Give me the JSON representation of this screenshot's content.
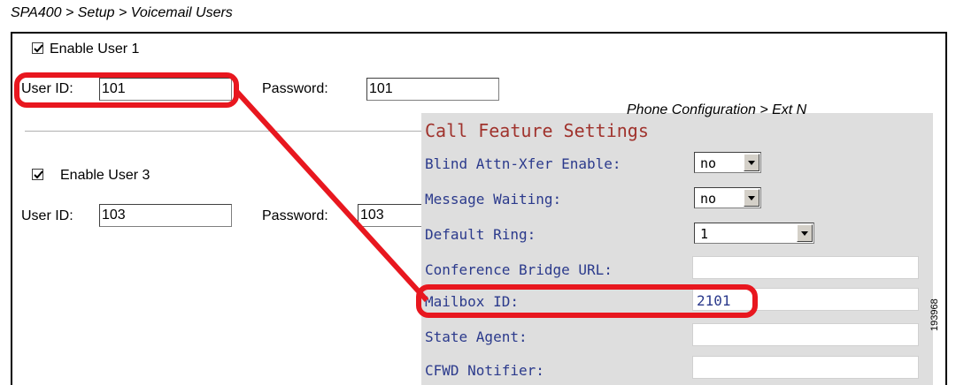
{
  "captions": {
    "top_left": "SPA400 > Setup > Voicemail Users",
    "phone_config": "Phone Configuration > Ext N"
  },
  "user1": {
    "enable_label": "Enable User 1",
    "enable_checked": true,
    "userid_label": "User ID:",
    "userid_value": "101",
    "password_label": "Password:",
    "password_value": "101"
  },
  "user3": {
    "enable_label": "Enable User 3",
    "enable_checked": true,
    "userid_label": "User ID:",
    "userid_value": "103",
    "password_label": "Password:",
    "password_value": "103"
  },
  "call_feature": {
    "title": "Call Feature Settings",
    "rows": [
      {
        "label": "Blind Attn-Xfer Enable:",
        "value": "no"
      },
      {
        "label": "Message Waiting:",
        "value": "no"
      },
      {
        "label": "Default Ring:",
        "value": "1"
      },
      {
        "label": "Conference Bridge URL:",
        "value": ""
      },
      {
        "label": "Mailbox ID:",
        "value": "2101"
      },
      {
        "label": "State Agent:",
        "value": ""
      },
      {
        "label": "CFWD Notifier:",
        "value": ""
      }
    ]
  },
  "figure_number": "193968",
  "colors": {
    "highlight": "#e8171f",
    "panel_bg": "#dedede",
    "label_blue": "#2b3a8c",
    "title_red": "#a0332d"
  }
}
